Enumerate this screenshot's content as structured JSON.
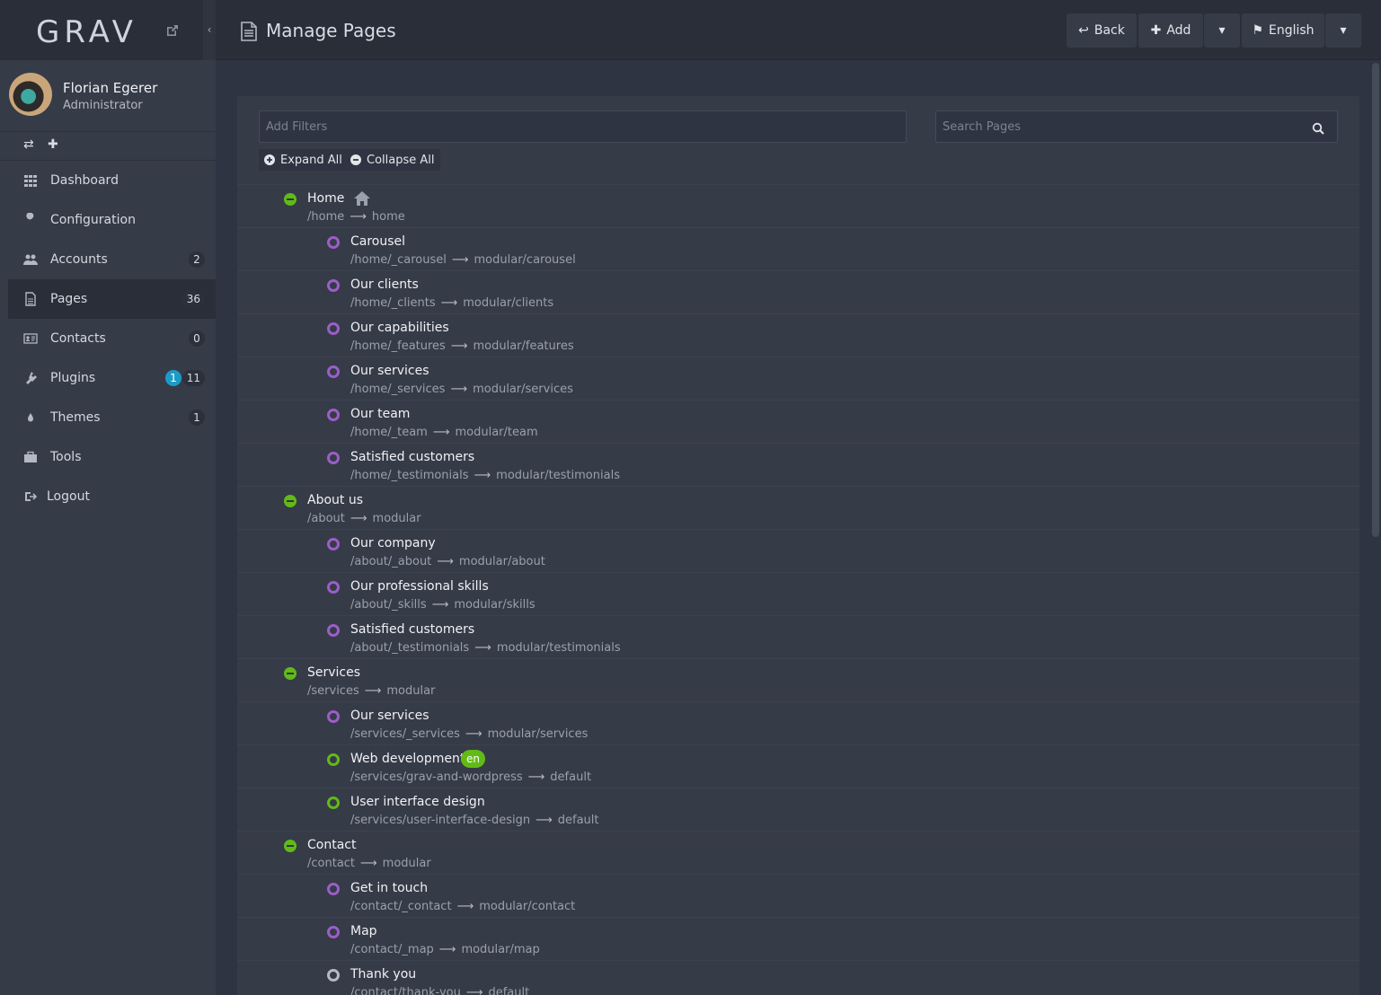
{
  "brand": {
    "logo": "GRAV"
  },
  "user": {
    "name": "Florian Egerer",
    "role": "Administrator"
  },
  "nav": [
    {
      "label": "Dashboard",
      "icon": "grid-icon",
      "badge": null,
      "active": false
    },
    {
      "label": "Configuration",
      "icon": "wrench-icon",
      "badge": null,
      "active": false
    },
    {
      "label": "Accounts",
      "icon": "users-icon",
      "badge": "2",
      "active": false
    },
    {
      "label": "Pages",
      "icon": "file-icon",
      "badge": "36",
      "active": true
    },
    {
      "label": "Contacts",
      "icon": "contact-card-icon",
      "badge": "0",
      "active": false
    },
    {
      "label": "Plugins",
      "icon": "plug-icon",
      "badge": "11",
      "badge_update": "1",
      "active": false
    },
    {
      "label": "Themes",
      "icon": "droplet-icon",
      "badge": "1",
      "active": false
    },
    {
      "label": "Tools",
      "icon": "briefcase-icon",
      "badge": null,
      "active": false
    },
    {
      "label": "Logout",
      "icon": "sign-out-icon",
      "badge": null,
      "active": false
    }
  ],
  "header": {
    "title": "Manage Pages",
    "back": "Back",
    "add": "Add",
    "language": "English"
  },
  "filters": {
    "add_filters_placeholder": "Add Filters",
    "search_placeholder": "Search Pages",
    "expand_all": "Expand All",
    "collapse_all": "Collapse All"
  },
  "pages": [
    {
      "level": 0,
      "title": "Home",
      "route": "/home",
      "template": "home",
      "status": "parent",
      "home": true
    },
    {
      "level": 1,
      "title": "Carousel",
      "route": "/home/_carousel",
      "template": "modular/carousel",
      "status": "mod"
    },
    {
      "level": 1,
      "title": "Our clients",
      "route": "/home/_clients",
      "template": "modular/clients",
      "status": "mod"
    },
    {
      "level": 1,
      "title": "Our capabilities",
      "route": "/home/_features",
      "template": "modular/features",
      "status": "mod"
    },
    {
      "level": 1,
      "title": "Our services",
      "route": "/home/_services",
      "template": "modular/services",
      "status": "mod"
    },
    {
      "level": 1,
      "title": "Our team",
      "route": "/home/_team",
      "template": "modular/team",
      "status": "mod"
    },
    {
      "level": 1,
      "title": "Satisfied customers",
      "route": "/home/_testimonials",
      "template": "modular/testimonials",
      "status": "mod"
    },
    {
      "level": 0,
      "title": "About us",
      "route": "/about",
      "template": "modular",
      "status": "parent"
    },
    {
      "level": 1,
      "title": "Our company",
      "route": "/about/_about",
      "template": "modular/about",
      "status": "mod"
    },
    {
      "level": 1,
      "title": "Our professional skills",
      "route": "/about/_skills",
      "template": "modular/skills",
      "status": "mod"
    },
    {
      "level": 1,
      "title": "Satisfied customers",
      "route": "/about/_testimonials",
      "template": "modular/testimonials",
      "status": "mod"
    },
    {
      "level": 0,
      "title": "Services",
      "route": "/services",
      "template": "modular",
      "status": "parent"
    },
    {
      "level": 1,
      "title": "Our services",
      "route": "/services/_services",
      "template": "modular/services",
      "status": "mod"
    },
    {
      "level": 1,
      "title": "Web development",
      "route": "/services/grav-and-wordpress",
      "template": "default",
      "status": "pub",
      "lang": "en"
    },
    {
      "level": 1,
      "title": "User interface design",
      "route": "/services/user-interface-design",
      "template": "default",
      "status": "pub"
    },
    {
      "level": 0,
      "title": "Contact",
      "route": "/contact",
      "template": "modular",
      "status": "parent"
    },
    {
      "level": 1,
      "title": "Get in touch",
      "route": "/contact/_contact",
      "template": "modular/contact",
      "status": "mod"
    },
    {
      "level": 1,
      "title": "Map",
      "route": "/contact/_map",
      "template": "modular/map",
      "status": "mod"
    },
    {
      "level": 1,
      "title": "Thank you",
      "route": "/contact/thank-you",
      "template": "default",
      "status": "gray"
    }
  ]
}
